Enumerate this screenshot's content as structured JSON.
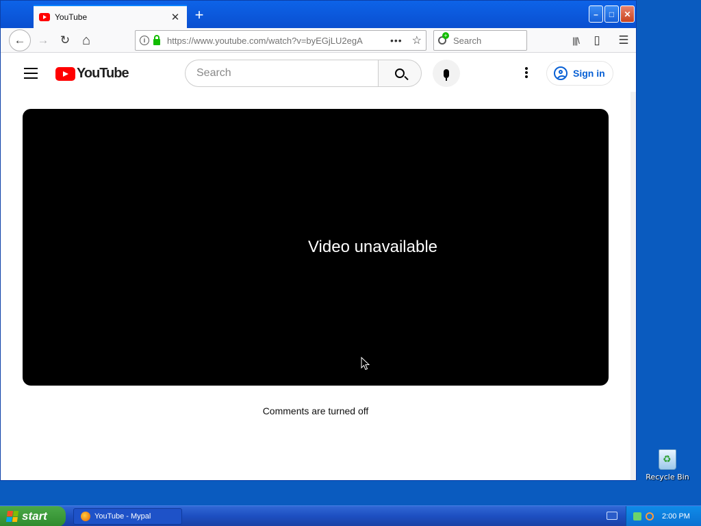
{
  "browser": {
    "tab_title": "YouTube",
    "tab_close": "✕",
    "new_tab": "+",
    "window_buttons": {
      "minimize": "–",
      "maximize": "□",
      "close": "✕"
    },
    "nav": {
      "back": "←",
      "forward": "→",
      "reload": "↻",
      "home": "⌂",
      "library": "|||\\",
      "sidebar": "▯",
      "menu": "☰"
    },
    "url": "https://www.youtube.com/watch?v=byEGjLU2egA",
    "page_actions": "•••",
    "bookmark_star": "☆",
    "search_placeholder": "Search"
  },
  "youtube": {
    "logo_text": "YouTube",
    "search_placeholder": "Search",
    "sign_in_label": "Sign in",
    "player_message": "Video unavailable",
    "comments_status": "Comments are turned off"
  },
  "desktop": {
    "recycle_bin_label": "Recycle Bin"
  },
  "taskbar": {
    "start_label": "start",
    "task_label": "YouTube - Mypal",
    "clock": "2:00 PM"
  },
  "colors": {
    "youtube_red": "#ff0000",
    "link_blue": "#065fd4",
    "desktop_blue": "#0a5bbf",
    "start_green": "#3a9a38"
  }
}
